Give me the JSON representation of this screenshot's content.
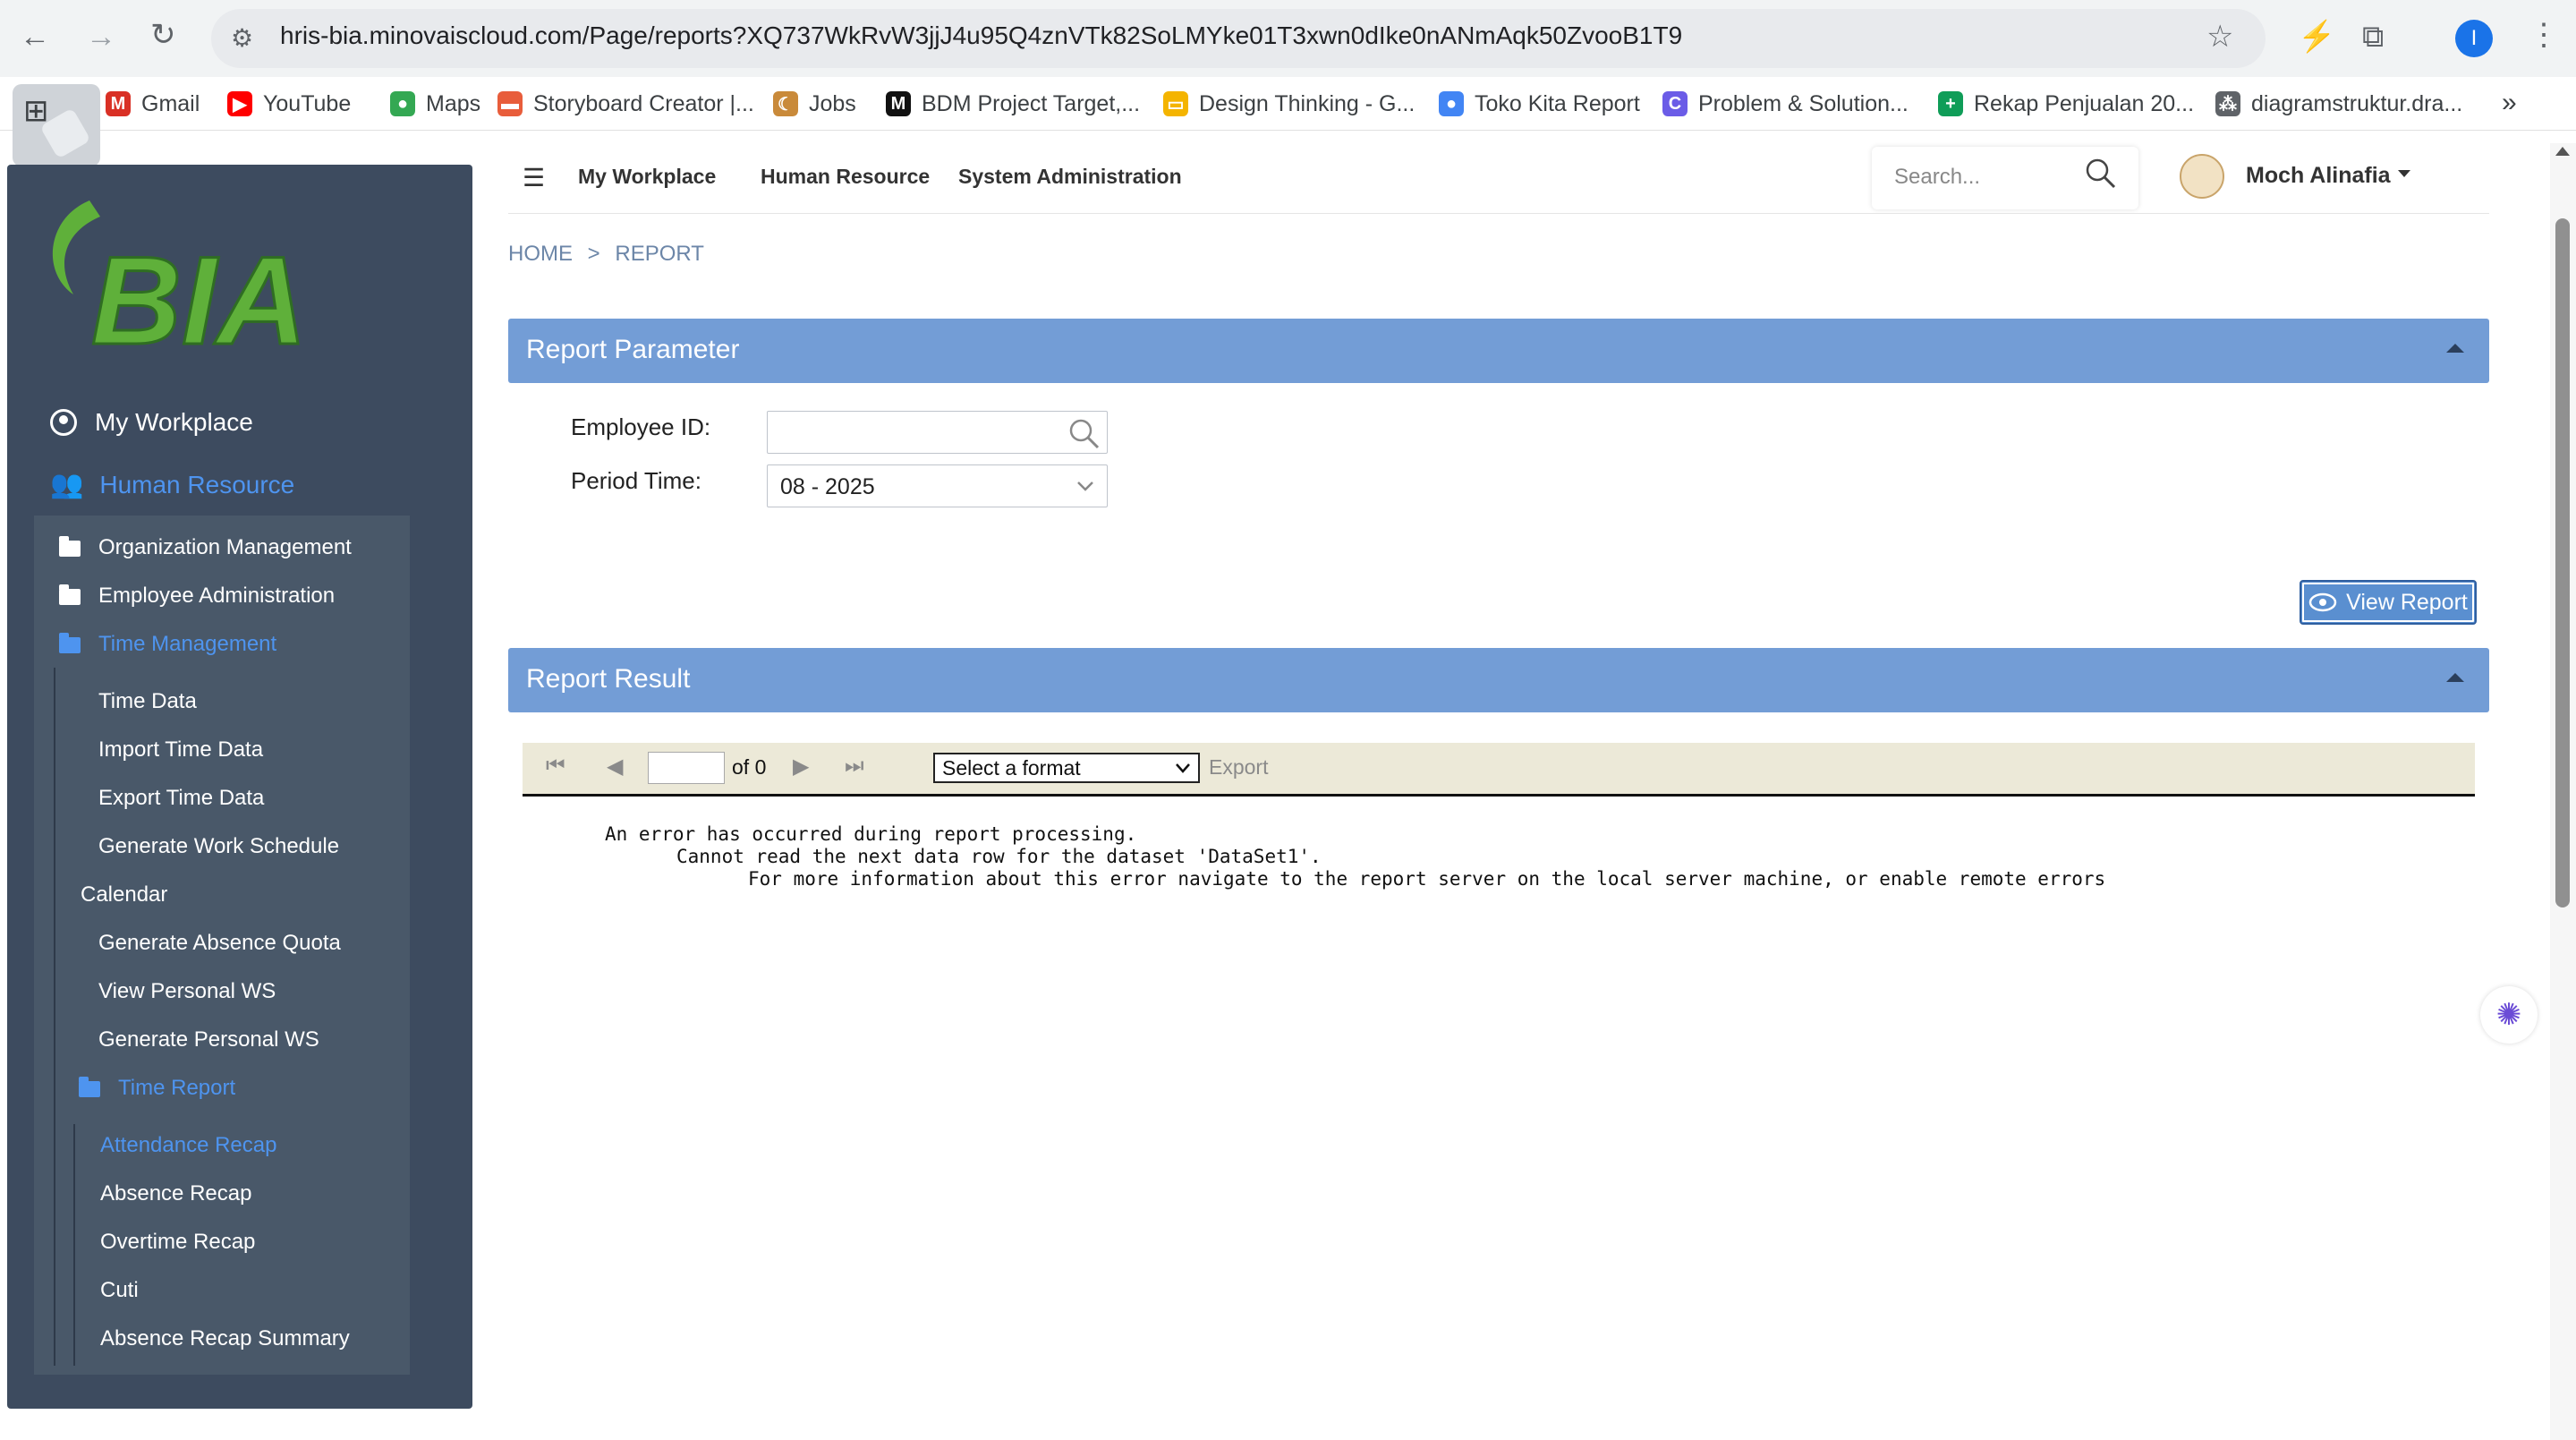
{
  "browser": {
    "url": "hris-bia.minovaiscloud.com/Page/reports?XQ737WkRvW3jjJ4u95Q4znVTk82SoLMYke01T3xwn0dIke0nANmAqk50ZvooB1T9",
    "profile_initial": "I",
    "bookmarks": [
      {
        "label": "Gmail",
        "icon": "gmail-icon",
        "color": "#d93025",
        "glyph": "M"
      },
      {
        "label": "YouTube",
        "icon": "youtube-icon",
        "color": "#ff0000",
        "glyph": "▶"
      },
      {
        "label": "Maps",
        "icon": "maps-icon",
        "color": "#34a853",
        "glyph": "●"
      },
      {
        "label": "Storyboard Creator |...",
        "icon": "storyboard-icon",
        "color": "#e85d3b",
        "glyph": "▬"
      },
      {
        "label": "Jobs",
        "icon": "jobs-icon",
        "color": "#c98a3a",
        "glyph": "☾"
      },
      {
        "label": "BDM Project Target,...",
        "icon": "bdm-icon",
        "color": "#111111",
        "glyph": "M"
      },
      {
        "label": "Design Thinking - G...",
        "icon": "slides-icon",
        "color": "#f4b400",
        "glyph": "▭"
      },
      {
        "label": "Toko Kita Report",
        "icon": "looker-icon",
        "color": "#4285f4",
        "glyph": "●"
      },
      {
        "label": "Problem & Solution...",
        "icon": "canva-icon",
        "color": "#6b5ce7",
        "glyph": "C"
      },
      {
        "label": "Rekap Penjualan 20...",
        "icon": "sheets-icon",
        "color": "#0f9d58",
        "glyph": "+"
      },
      {
        "label": "diagramstruktur.dra...",
        "icon": "diagram-icon",
        "color": "#5f6368",
        "glyph": "⁂"
      }
    ]
  },
  "sidebar": {
    "logo_text": "BIA",
    "my_workplace": "My Workplace",
    "human_resource": "Human Resource",
    "groups": [
      "Organization Management",
      "Employee Administration",
      "Time Management"
    ],
    "time_management_items": [
      "Time Data",
      "Import Time Data",
      "Export Time Data",
      "Generate Work Schedule"
    ],
    "calendar": "Calendar",
    "time_management_items_2": [
      "Generate Absence Quota",
      "View Personal WS",
      "Generate Personal WS"
    ],
    "time_report": "Time Report",
    "time_report_items": [
      "Attendance Recap",
      "Absence Recap",
      "Overtime Recap",
      "Cuti",
      "Absence Recap Summary"
    ],
    "accent_color": "#4e94ef"
  },
  "header": {
    "nav": [
      "My Workplace",
      "Human Resource",
      "System Administration"
    ],
    "search_placeholder": "Search...",
    "user_name": "Moch Alinafia"
  },
  "breadcrumb": {
    "home": "HOME",
    "separator": ">",
    "current": "REPORT"
  },
  "report_parameter": {
    "title": "Report Parameter",
    "employee_id_label": "Employee ID:",
    "employee_id_value": "",
    "period_label": "Period Time:",
    "period_value": "08 - 2025",
    "view_button": "View Report"
  },
  "report_result": {
    "title": "Report Result",
    "page_value": "",
    "of_label": "of 0",
    "format_placeholder": "Select a format",
    "export_label": "Export",
    "error_lines": [
      "An error has occurred during report processing.",
      "Cannot read the next data row for the dataset 'DataSet1'.",
      "For more information about this error navigate to the report server on the local server machine, or enable remote errors"
    ]
  }
}
